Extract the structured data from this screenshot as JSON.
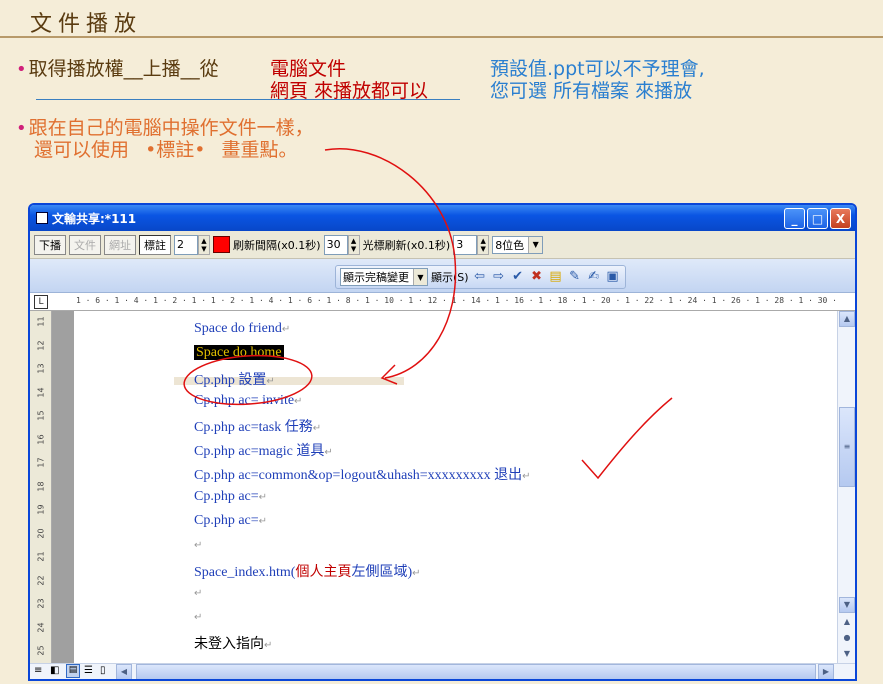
{
  "slide": {
    "title": "文件播放",
    "bullet1": {
      "part_a": "取得播放權__上播__從",
      "red_line1": "電腦文件",
      "red_line2": "網頁  來播放都可以"
    },
    "note": {
      "line1": "預設值.ppt可以不予理會,",
      "line2": "您可選  所有檔案  來播放"
    },
    "bullet2": {
      "line1": "跟在自己的電腦中操作文件一樣，",
      "line2a": "還可以使用",
      "line2b": "•標註•",
      "line2c": "畫重點。"
    }
  },
  "window": {
    "title": "文輸共享:*111",
    "buttons": {
      "minimize": "_",
      "maximize": "□",
      "close": "X"
    }
  },
  "toolbar": {
    "down_label": "下播",
    "file_label": "文件",
    "web_label": "網址",
    "annot_label": "標註",
    "pen_width": "2",
    "refresh_label": "刷新間隔(x0.1秒)",
    "refresh_value": "30",
    "cursor_label": "光標刷新(x0.1秒)",
    "cursor_value": "3",
    "color_depth": "8位色"
  },
  "toolbar2": {
    "show_final": "顯示完稿變更",
    "show_label": "顯示(S)"
  },
  "ruler": {
    "marks": "1 · 6 · 1 · 4 · 1 · 2 · 1  ·  1 · 2 · 1 · 4 · 1 · 6 · 1 · 8 · 1 · 10 · 1 · 12 · 1 · 14 · 1 · 16 · 1 · 18 · 1 · 20 · 1 · 22 · 1 · 24 · 1 · 26 · 1 · 28 · 1 · 30 · 1 · 32 · 1 · 34 · 1 · 36 · 1 · 38 · 1 · 40",
    "vmarks": [
      "11",
      "12",
      "13",
      "14",
      "15",
      "16",
      "17",
      "18",
      "19",
      "20",
      "21",
      "22",
      "23",
      "24",
      "25"
    ]
  },
  "document": {
    "lines": [
      {
        "text": "Space do friend"
      },
      {
        "text": "Space do home"
      },
      {
        "text": "Cp.php 設置"
      },
      {
        "text": "Cp.php ac= invite"
      },
      {
        "text": "Cp.php ac=task 任務"
      },
      {
        "text": "Cp.php ac=magic 道具"
      },
      {
        "text": "Cp.php ac=common&op=logout&uhash=xxxxxxxxx 退出"
      },
      {
        "text": "Cp.php ac="
      },
      {
        "text": "Cp.php ac="
      },
      {
        "text": ""
      },
      {
        "text_a": "Space_index.htm(",
        "text_b": "個人主頁",
        "text_c": "左側區域)"
      },
      {
        "text": ""
      },
      {
        "text": ""
      },
      {
        "text": "未登入指向"
      }
    ],
    "para_mark": "↵"
  },
  "colors": {
    "accent_blue": "#0a46d8",
    "red": "#c00000",
    "doc_blue": "#1f3fb8"
  }
}
